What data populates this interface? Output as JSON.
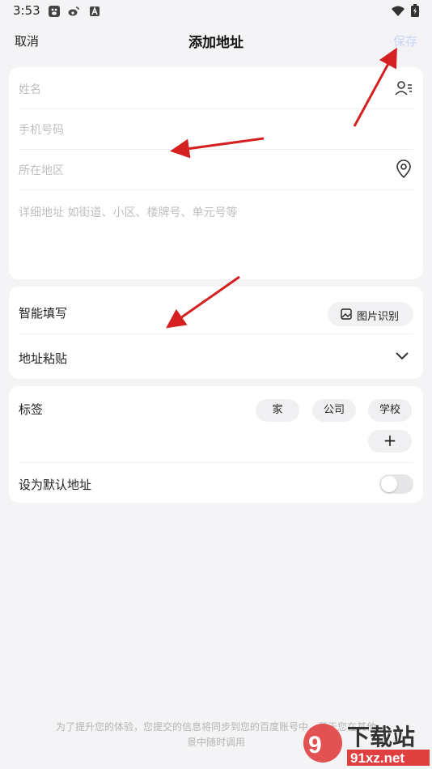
{
  "status_bar": {
    "time": "3:53"
  },
  "nav": {
    "cancel": "取消",
    "title": "添加地址",
    "save": "保存"
  },
  "form": {
    "name_placeholder": "姓名",
    "phone_placeholder": "手机号码",
    "region_placeholder": "所在地区",
    "detail_placeholder": "详细地址  如街道、小区、楼牌号、单元号等"
  },
  "smart": {
    "smart_fill_label": "智能填写",
    "image_recognize_label": "图片识别",
    "paste_label": "地址粘贴"
  },
  "tags": {
    "label": "标签",
    "options": [
      "家",
      "公司",
      "学校"
    ],
    "add_symbol": "+"
  },
  "default_address": {
    "label": "设为默认地址",
    "enabled": false
  },
  "footer": {
    "line1": "为了提升您的体验，您提交的信息将同步到您的百度账号中，便于您在其他",
    "line2": "景中随时调用"
  },
  "watermark": {
    "text": "下载站",
    "url_text": "91xz.net"
  },
  "colors": {
    "annotation_arrow": "#d42020",
    "save_disabled": "#c9d4f7"
  }
}
